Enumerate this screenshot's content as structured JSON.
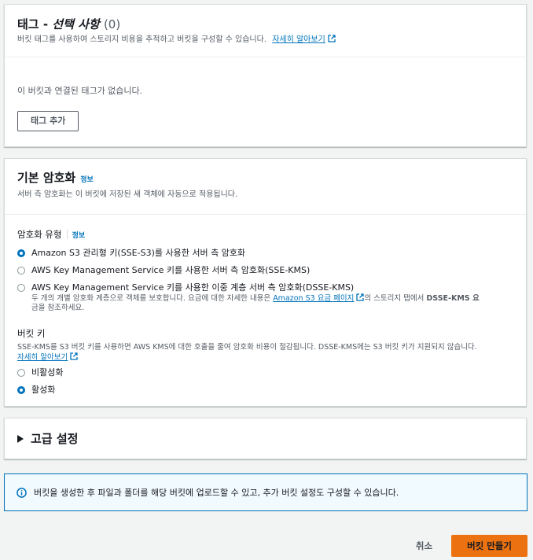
{
  "tags": {
    "title": "태그 - 선택 사항",
    "title_prefix": "태그 - ",
    "title_optional": "선택 사항",
    "count": "(0)",
    "description": "버킷 태그를 사용하여 스토리지 비용을 추적하고 버킷을 구성할 수 있습니다.",
    "learn_more": "자세히 알아보기",
    "empty_message": "이 버킷과 연결된 태그가 없습니다.",
    "add_tag_button": "태그 추가"
  },
  "encryption": {
    "title": "기본 암호화",
    "info": "정보",
    "description": "서버 측 암호화는 이 버킷에 저장된 새 객체에 자동으로 적용됩니다.",
    "type_label": "암호화 유형",
    "type_info": "정보",
    "options": [
      {
        "label": "Amazon S3 관리형 키(SSE-S3)를 사용한 서버 측 암호화",
        "checked": true
      },
      {
        "label": "AWS Key Management Service 키를 사용한 서버 측 암호화(SSE-KMS)",
        "checked": false
      },
      {
        "label": "AWS Key Management Service 키를 사용한 이중 계층 서버 측 암호화(DSSE-KMS)",
        "checked": false
      }
    ],
    "dsse_desc_1": "두 개의 개별 암호화 계층으로 객체를 보호합니다. 요금에 대한 자세한 내용은 ",
    "dsse_link": "Amazon S3 요금 페이지",
    "dsse_desc_2": "의 스토리지 탭에서 ",
    "dsse_bold": "DSSE-KMS 요",
    "dsse_desc_3": "금을 참조하세요.",
    "bucket_key_label": "버킷 키",
    "bucket_key_desc": "SSE-KMS를 S3 버킷 키를 사용하면 AWS KMS에 대한 호출을 줄여 암호화 비용이 절감됩니다. DSSE-KMS에는 S3 버킷 키가 지원되지 않습니다.",
    "bucket_key_learn_more": "자세히 알아보기",
    "bucket_key_options": [
      {
        "label": "비활성화",
        "checked": false
      },
      {
        "label": "활성화",
        "checked": true
      }
    ]
  },
  "advanced": {
    "title": "고급 설정"
  },
  "info_banner": {
    "text": "버킷을 생성한 후 파일과 폴더를 해당 버킷에 업로드할 수 있고, 추가 버킷 설정도 구성할 수 있습니다."
  },
  "footer": {
    "cancel": "취소",
    "create": "버킷 만들기"
  },
  "colors": {
    "link": "#0073bb",
    "primary": "#ec7211",
    "info_border": "#0073bb",
    "background": "#f2f3f3"
  }
}
